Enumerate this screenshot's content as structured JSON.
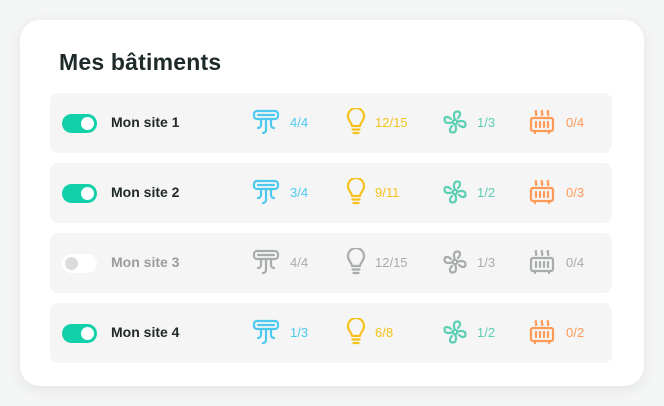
{
  "title": "Mes bâtiments",
  "colors": {
    "toggle_on": "#12d0a9",
    "ventilation": "#4cc9ef",
    "lighting": "#f5c21b",
    "fan": "#5ccfb4",
    "heating": "#ff9a57",
    "disabled": "#a9acac"
  },
  "sites": [
    {
      "name": "Mon site 1",
      "enabled": true,
      "ventilation": "4/4",
      "lighting": "12/15",
      "fan": "1/3",
      "heating": "0/4"
    },
    {
      "name": "Mon site 2",
      "enabled": true,
      "ventilation": "3/4",
      "lighting": "9/11",
      "fan": "1/2",
      "heating": "0/3"
    },
    {
      "name": "Mon site 3",
      "enabled": false,
      "ventilation": "4/4",
      "lighting": "12/15",
      "fan": "1/3",
      "heating": "0/4"
    },
    {
      "name": "Mon site 4",
      "enabled": true,
      "ventilation": "1/3",
      "lighting": "6/8",
      "fan": "1/2",
      "heating": "0/2"
    }
  ],
  "icons": {
    "ventilation": "ventilation-icon",
    "lighting": "lightbulb-icon",
    "fan": "fan-icon",
    "heating": "radiator-icon"
  }
}
